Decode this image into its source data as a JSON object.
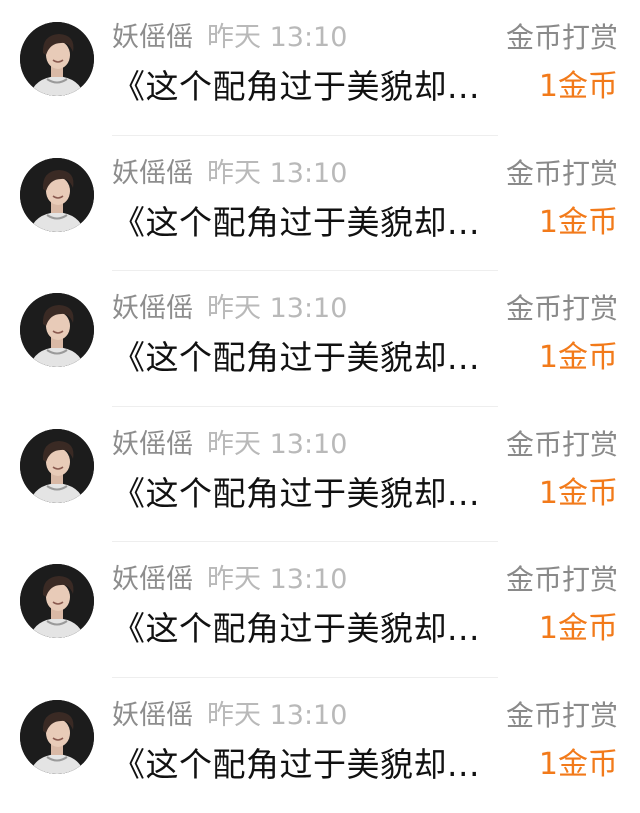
{
  "records": [
    {
      "user": "妖傜傜",
      "time": "昨天 13:10",
      "action": "金币打赏",
      "title": "《这个配角过于美貌却...",
      "amount": "1金币",
      "avatar": "avatar-photo"
    },
    {
      "user": "妖傜傜",
      "time": "昨天 13:10",
      "action": "金币打赏",
      "title": "《这个配角过于美貌却...",
      "amount": "1金币",
      "avatar": "avatar-photo"
    },
    {
      "user": "妖傜傜",
      "time": "昨天 13:10",
      "action": "金币打赏",
      "title": "《这个配角过于美貌却...",
      "amount": "1金币",
      "avatar": "avatar-photo"
    },
    {
      "user": "妖傜傜",
      "time": "昨天 13:10",
      "action": "金币打赏",
      "title": "《这个配角过于美貌却...",
      "amount": "1金币",
      "avatar": "avatar-photo"
    },
    {
      "user": "妖傜傜",
      "time": "昨天 13:10",
      "action": "金币打赏",
      "title": "《这个配角过于美貌却...",
      "amount": "1金币",
      "avatar": "avatar-photo"
    },
    {
      "user": "妖傜傜",
      "time": "昨天 13:10",
      "action": "金币打赏",
      "title": "《这个配角过于美貌却...",
      "amount": "1金币",
      "avatar": "avatar-photo"
    }
  ],
  "colors": {
    "coin_accent": "#f27a1a",
    "name_gray": "#8d8d8d",
    "time_gray": "#b9b9b9",
    "title_black": "#111111"
  }
}
